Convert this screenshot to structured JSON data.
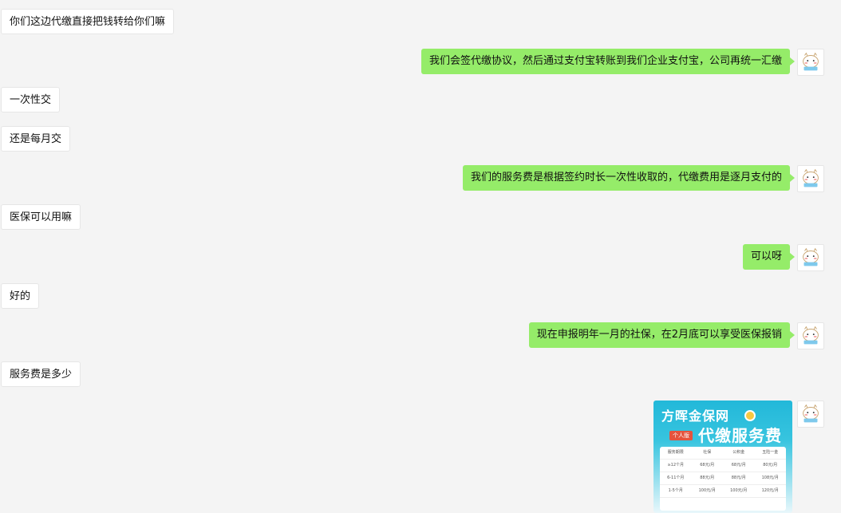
{
  "messages": [
    {
      "side": "left",
      "text": "你们这边代缴直接把钱转给你们嘛"
    },
    {
      "side": "right",
      "text": "我们会签代缴协议，然后通过支付宝转账到我们企业支付宝，公司再统一汇缴"
    },
    {
      "side": "left",
      "text": "一次性交"
    },
    {
      "side": "left",
      "text": "还是每月交"
    },
    {
      "side": "right",
      "text": "我们的服务费是根据签约时长一次性收取的，代缴费用是逐月支付的"
    },
    {
      "side": "left",
      "text": "医保可以用嘛"
    },
    {
      "side": "right",
      "text": "可以呀"
    },
    {
      "side": "left",
      "text": "好的"
    },
    {
      "side": "right",
      "text": "现在申报明年一月的社保，在2月底可以享受医保报销"
    },
    {
      "side": "left",
      "text": "服务费是多少"
    }
  ],
  "poster": {
    "brand": "方晖金保网",
    "title": "代缴服务费",
    "tag": "个人版",
    "table_headers": [
      "服务期限",
      "社保",
      "公积金",
      "五险一金"
    ],
    "table_rows": [
      [
        "≥12个月",
        "68元/月",
        "68元/月",
        "80元/月"
      ],
      [
        "6-11个月",
        "88元/月",
        "88元/月",
        "108元/月"
      ],
      [
        "1-5个月",
        "100元/月",
        "100元/月",
        "120元/月"
      ]
    ]
  },
  "colors": {
    "background": "#f4f4f4",
    "left_bubble": "#ffffff",
    "right_bubble": "#95ec69"
  }
}
